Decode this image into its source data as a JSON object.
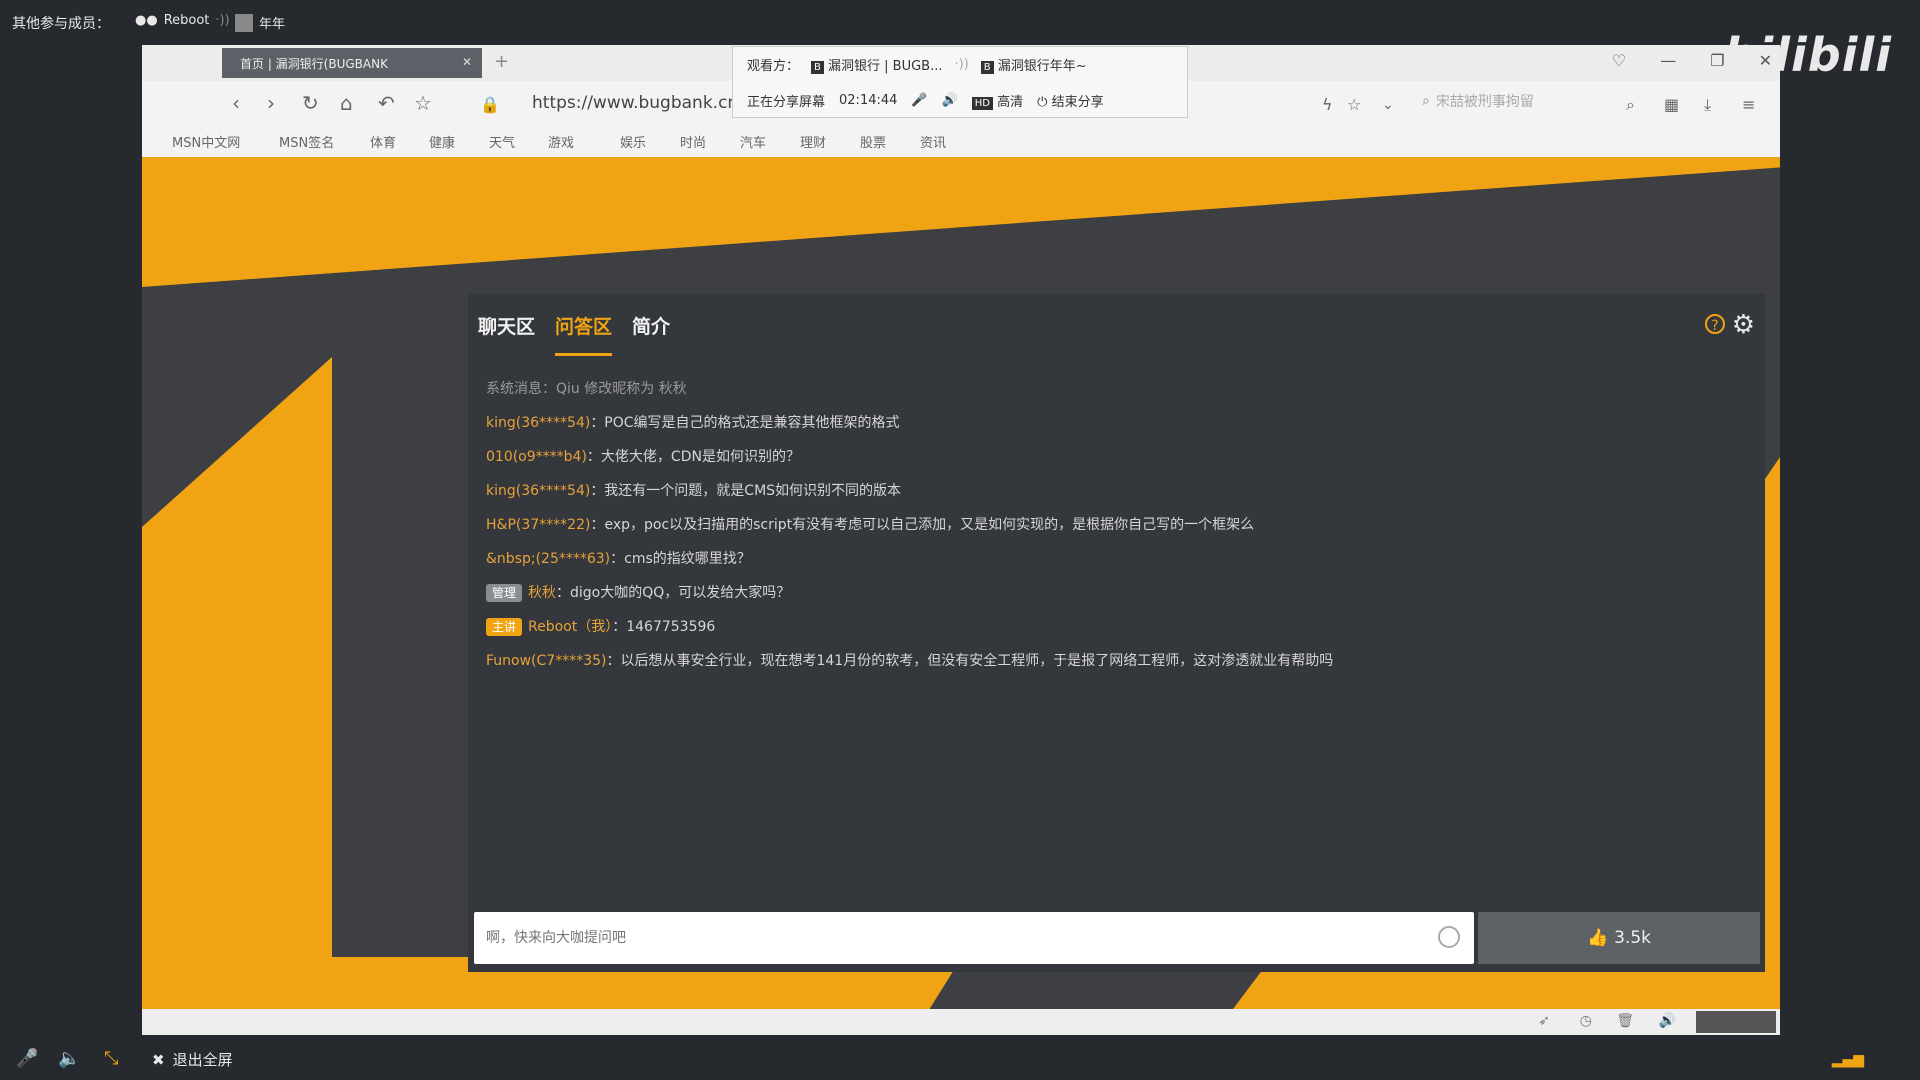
{
  "topbar": {
    "participants_label": "其他参与成员：",
    "members": [
      {
        "name": "Reboot"
      },
      {
        "name": "年年"
      }
    ]
  },
  "watermark": "bilibili",
  "browser": {
    "tab_title": "首页 | 漏洞银行(BUGBANK",
    "url": "https://www.bugbank.cn",
    "search_placeholder": "宋喆被刑事拘留",
    "favorites": [
      "MSN中文网",
      "MSN签名",
      "体育",
      "健康",
      "天气",
      "游戏",
      "娱乐",
      "时尚",
      "汽车",
      "理财",
      "股票",
      "资讯"
    ]
  },
  "share": {
    "viewers_label": "观看方：",
    "viewer1": "漏洞银行 | BUGB...",
    "viewer2": "漏洞银行年年~",
    "sharing_label": "正在分享屏幕",
    "timer": "02:14:44",
    "hd_chip": "HD",
    "hd_label": "高清",
    "end_label": "结束分享"
  },
  "panel": {
    "tabs": [
      {
        "label": "聊天区",
        "active": false
      },
      {
        "label": "问答区",
        "active": true
      },
      {
        "label": "简介",
        "active": false
      }
    ],
    "messages": [
      {
        "type": "system",
        "text": "系统消息：Qiu 修改昵称为 秋秋"
      },
      {
        "name": "king(36****54)",
        "text": "：POC编写是自己的格式还是兼容其他框架的格式"
      },
      {
        "name": "010(o9****b4)",
        "text": "：大佬大佬，CDN是如何识别的？"
      },
      {
        "name": "king(36****54)",
        "text": "：我还有一个问题，就是CMS如何识别不同的版本"
      },
      {
        "name": "H&P(37****22)",
        "text": "：exp，poc以及扫描用的script有没有考虑可以自己添加，又是如何实现的，是根据你自己写的一个框架么"
      },
      {
        "name": "&nbsp;(25****63)",
        "text": "：cms的指纹哪里找？"
      },
      {
        "badge": "管理",
        "name": "秋秋",
        "text": "：digo大咖的QQ，可以发给大家吗？"
      },
      {
        "badge": "主讲",
        "name": "Reboot（我）",
        "text": "：1467753596"
      },
      {
        "name": "Funow(C7****35)",
        "text": "：以后想从事安全行业，现在想考141月份的软考，但没有安全工程师，于是报了网络工程师，这对渗透就业有帮助吗"
      }
    ],
    "input_placeholder": "啊，快来向大咖提问吧",
    "like_count": "3.5k"
  },
  "bottombar": {
    "exit_fullscreen": "退出全屏"
  }
}
